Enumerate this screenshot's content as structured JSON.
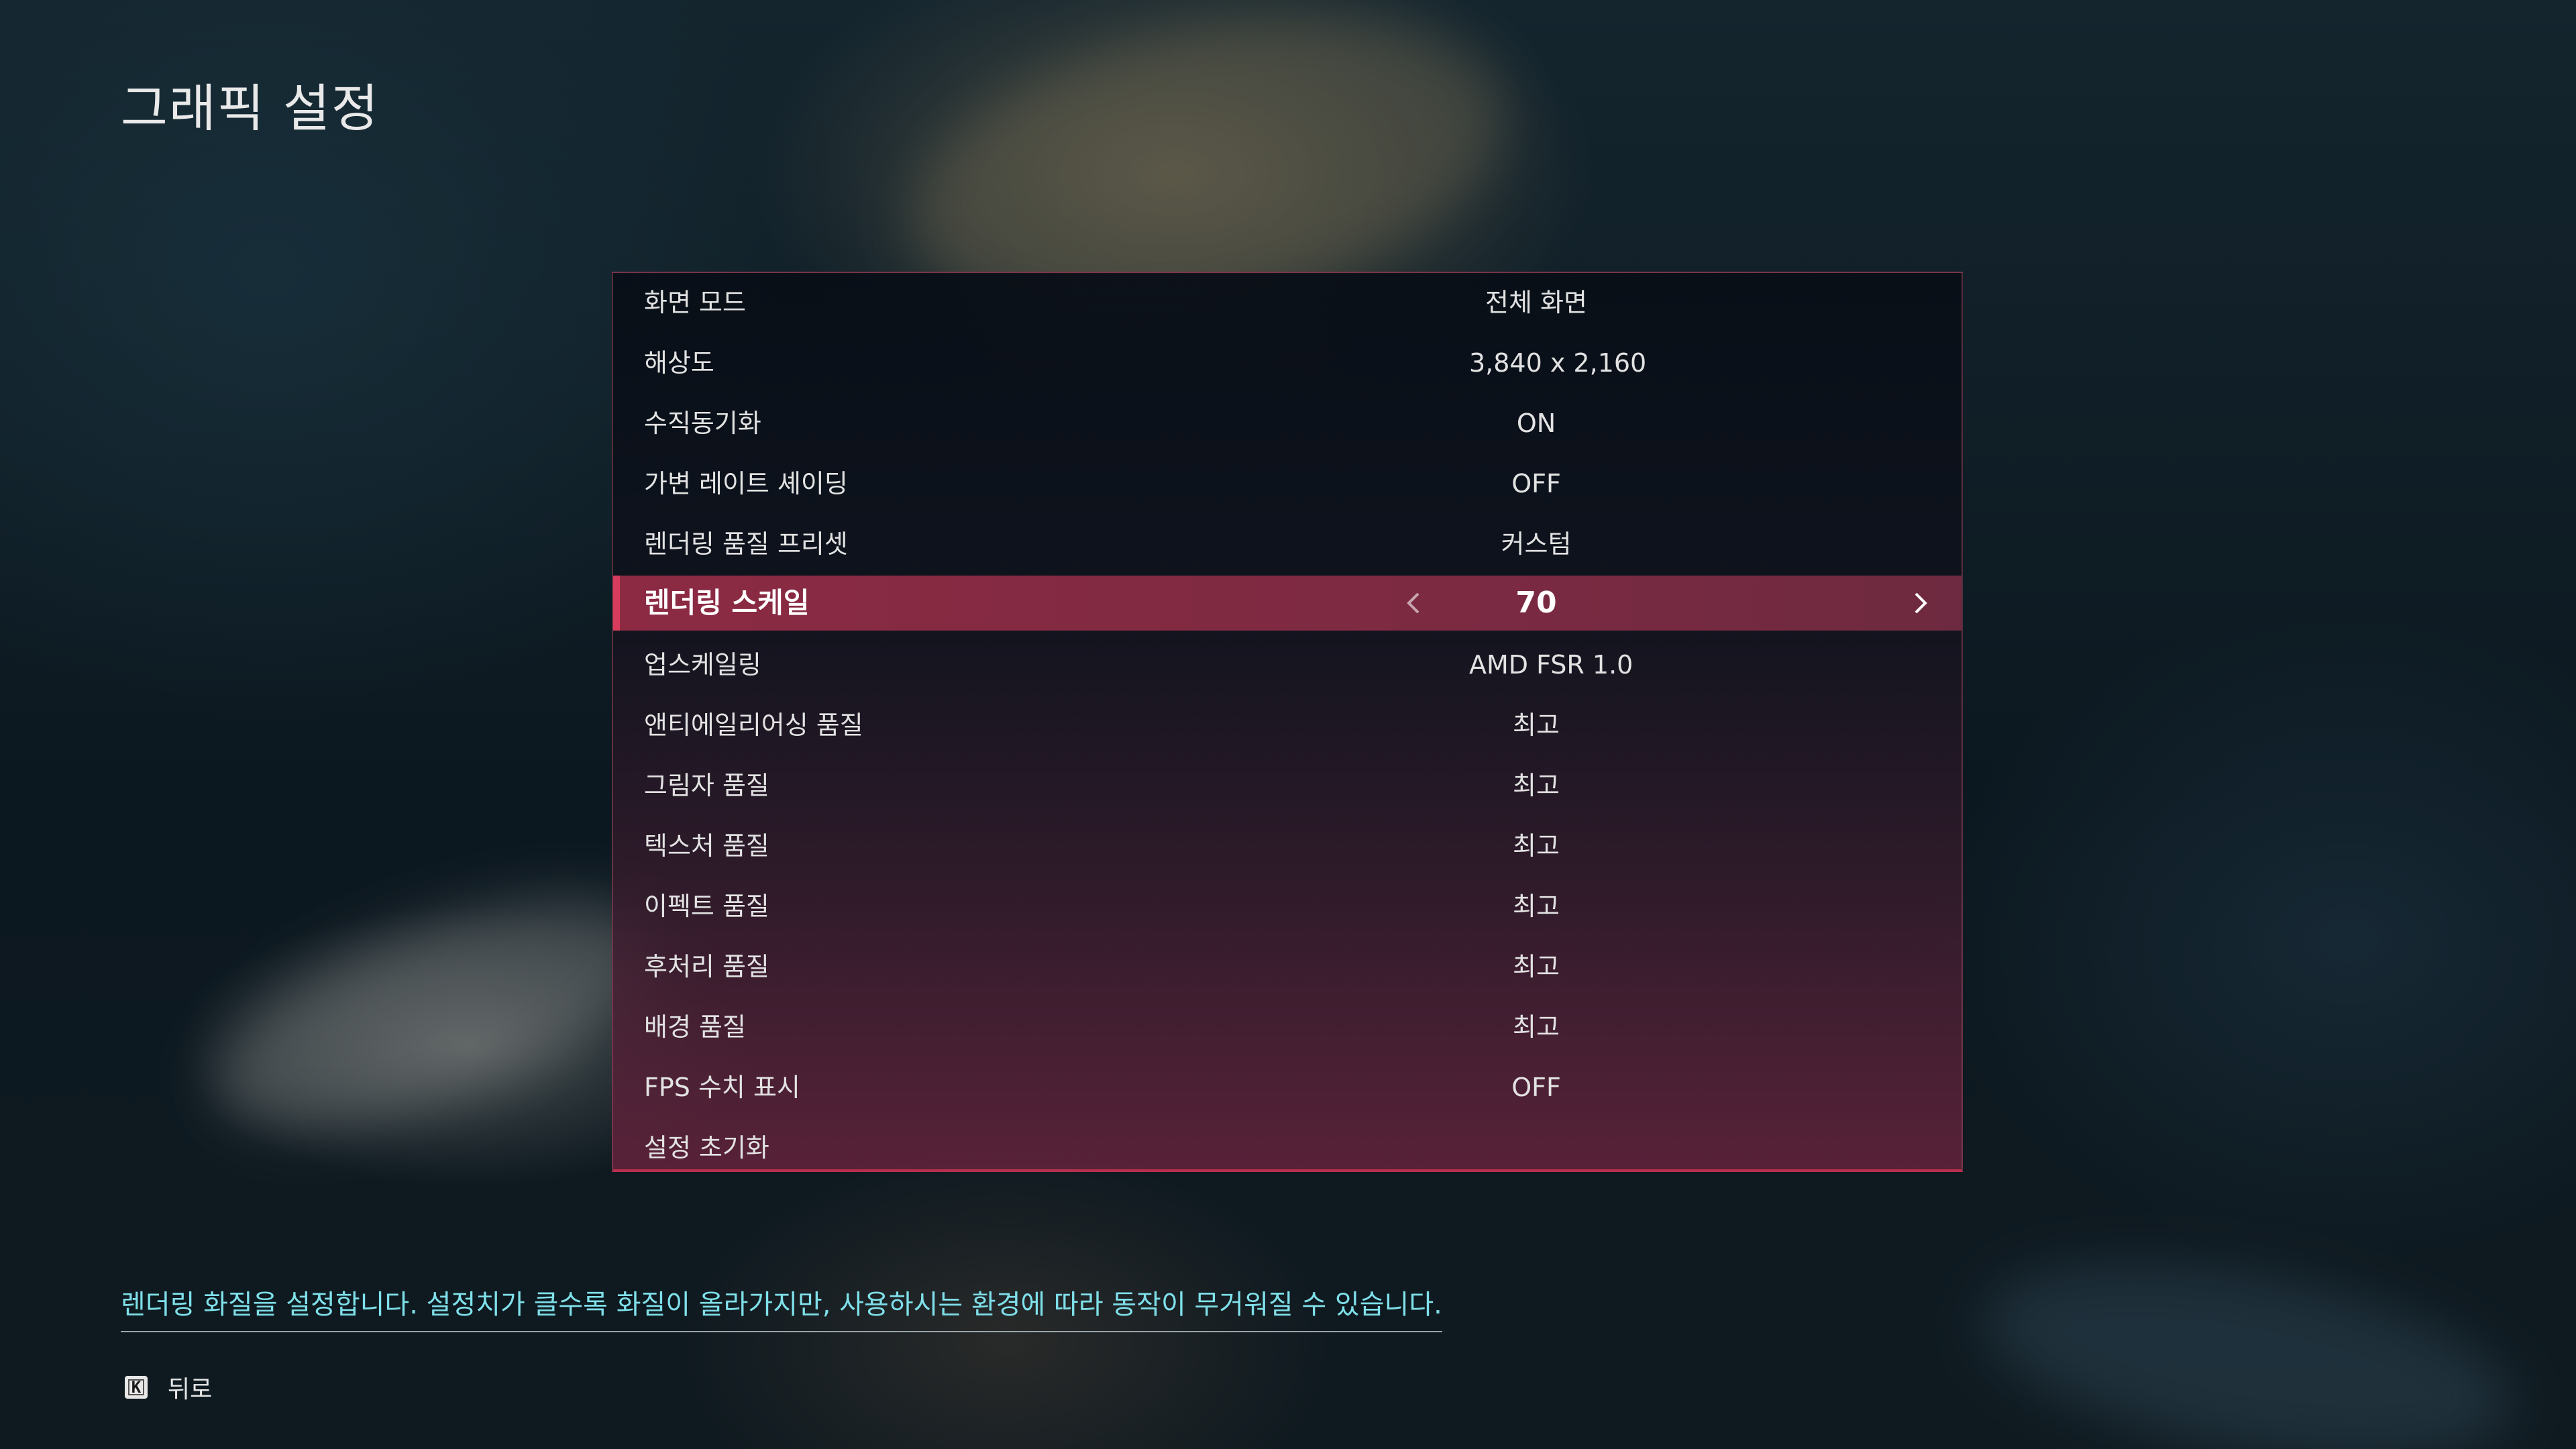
{
  "page": {
    "title": "그래픽 설정",
    "help_text": "렌더링 화질을 설정합니다. 설정치가 클수록 화질이 올라가지만, 사용하시는 환경에 따라 동작이 무거워질 수 있습니다.",
    "back": {
      "key": "K",
      "label": "뒤로"
    }
  },
  "settings": [
    {
      "label": "화면 모드",
      "value": "전체 화면"
    },
    {
      "label": "해상도",
      "value": "3,840 x 2,160"
    },
    {
      "label": "수직동기화",
      "value": "ON"
    },
    {
      "label": "가변 레이트 셰이딩",
      "value": "OFF"
    },
    {
      "label": "렌더링 품질 프리셋",
      "value": "커스텀"
    },
    {
      "label": "렌더링 스케일",
      "value": "70",
      "selected": true
    },
    {
      "label": "업스케일링",
      "value": "AMD FSR 1.0"
    },
    {
      "label": "앤티에일리어싱 품질",
      "value": "최고"
    },
    {
      "label": "그림자 품질",
      "value": "최고"
    },
    {
      "label": "텍스처 품질",
      "value": "최고"
    },
    {
      "label": "이펙트 품질",
      "value": "최고"
    },
    {
      "label": "후처리 품질",
      "value": "최고"
    },
    {
      "label": "배경 품질",
      "value": "최고"
    },
    {
      "label": "FPS 수치 표시",
      "value": "OFF"
    },
    {
      "label": "설정 초기화",
      "value": ""
    }
  ],
  "colors": {
    "accent": "#d83c5c",
    "selected_row": "#8c2a43",
    "help_text": "#7fe0ea"
  },
  "icons": {
    "left": "chevron-left-icon",
    "right": "chevron-right-icon",
    "key": "keyboard-key-icon"
  }
}
